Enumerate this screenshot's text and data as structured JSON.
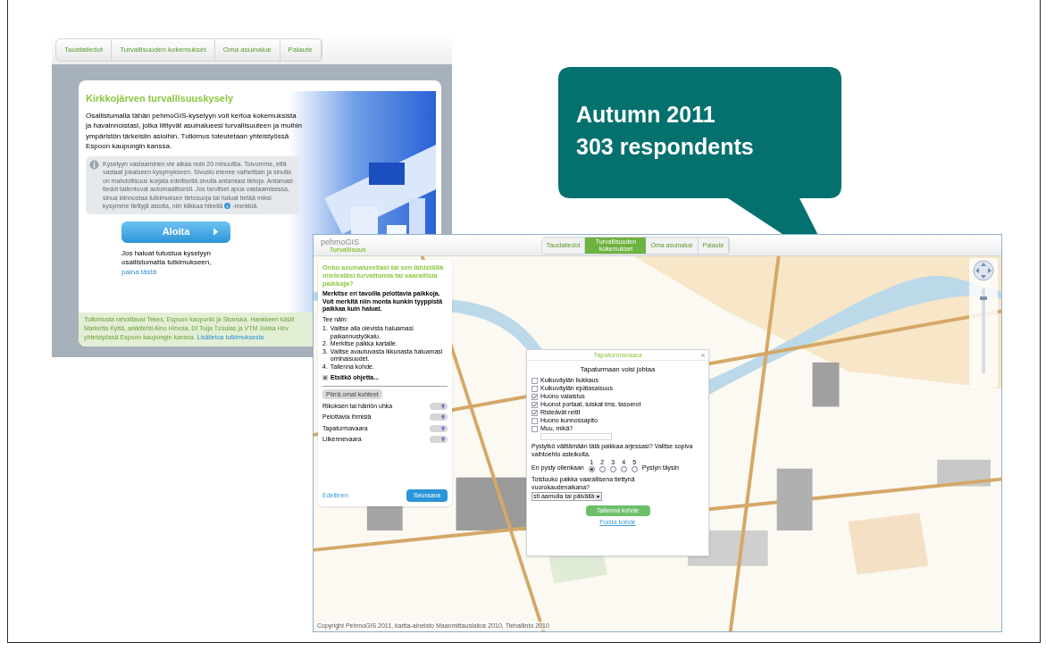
{
  "survey_intro": {
    "tabs": [
      {
        "label": "Taustatiedot",
        "selected": false
      },
      {
        "label": "Turvallisuuden kokemukset",
        "selected": false
      },
      {
        "label": "Oma asuinalue",
        "selected": false
      },
      {
        "label": "Palaute",
        "selected": false
      }
    ],
    "title": "Kirkkojärven turvallisuuskysely",
    "intro": "Osallistumalla tähän pehmoGIS-kyselyyn voit kertoa kokemuksista ja havainnoistasi, jotka liittyvät asuinalueesi turvallisuuteen ja muihin ympäristön tärkeisiin asioihin. Tutkimus toteutetaan yhteistyössä Espoon kaupungin kanssa.",
    "info_note": "Kyselyyn vastaaminen vie aikaa noin 20 minuuttia. Toivomme, että vastaat jokaiseen kysymykseen. Sivusto etenee vaiheittain ja sinulla on mahdollisuus korjata edellisellä sivulla antamiasi tietoja. Antamasi tiedot tallentuvat automaattisesti. Jos tarvitset apua vastaamisessa, sinua kiinnostaa tutkimuksen tietosuoja tai haluat tietää miksi ",
    "info_note_last": "kysymme tiettyjä asioita, niin klikkaa hiirellä",
    "info_note_end": "-merkkiä.",
    "start_button": "Aloita",
    "explore_text": "Jos haluat tutustua kyselyyn osallistumatta tutkimukseen,",
    "explore_link": "paina tästä",
    "footer_lines": [
      "Tutkimusta rahoittavat Tekes, Espoon kaupunki ja Skanska. Hankkeen käsill",
      "Marketta Kyttä, arkkitehti Aino Hirvola, DI Tuija Tzoulas ja VTM Jukka Hirv",
      "yhteistyössä Espoon kaupungin kanssa."
    ],
    "footer_link": "Lisätietoa tutkimuksesta",
    "footer_end": "."
  },
  "map_survey": {
    "logo": "pehmoGIS",
    "logo_subtitle": "Turvallisuus",
    "steps": [
      {
        "label": "Taustatiedot",
        "selected": false
      },
      {
        "label": "Turvallisuuden kokemukset",
        "selected": true
      },
      {
        "label": "Oma asuinalue",
        "selected": false
      },
      {
        "label": "Palaute",
        "selected": false
      }
    ],
    "side_panel": {
      "question": "Onko asuinalueellasi tai sen lähistöllä mielestäsi turvattomia tai vaarallisia paikkoja?",
      "description": "Merkitse eri tavoilla pelottavia paikkoja. Voit merkitä niin monta kunkin tyyppistä paikkaa kuin haluat.",
      "how_label": "Tee näin:",
      "instructions": [
        {
          "number": "1.",
          "text": "Valitse alla olevista haluamasi paikannustyökalu."
        },
        {
          "number": "2.",
          "text": "Merkitse paikka kartalle."
        },
        {
          "number": "3.",
          "text": "Valitse avautuvasta ikkunasta haluamasi ominaisuudet."
        },
        {
          "number": "4.",
          "text": "Tallenna kohde."
        }
      ],
      "help_toggle": "Etsitkö ohjetta...",
      "draw_button": "Piirrä omat kohteet",
      "categories": [
        "Rikoksen tai häiriön uhka",
        "Pelottavia ihmisiä",
        "Tapaturmavaara",
        "Liikennevaara"
      ],
      "back_link": "Edellinen",
      "next_button": "Seuraava"
    },
    "popup": {
      "title": "Tapaturmavaara",
      "heading": "Tapaturmaan voisi johtaa",
      "options": [
        {
          "label": "Kulkuväylän liukkaus",
          "checked": false
        },
        {
          "label": "Kulkuväylän epätasaisuus",
          "checked": false
        },
        {
          "label": "Huono valaistus",
          "checked": true
        },
        {
          "label": "Huonot portaat, luiskat tms. tasoerot",
          "checked": true
        },
        {
          "label": "Risteävät reitit",
          "checked": true
        },
        {
          "label": "Huono kunnossapito",
          "checked": false
        },
        {
          "label": "Muu, mikä?",
          "checked": false
        }
      ],
      "question_avoid": "Pystytkö välttämään tätä paikkaa arjessasi? Valitse sopiva vaihtoehto asteikolta.",
      "scale": [
        {
          "label": "1",
          "selected": true
        },
        {
          "label": "2",
          "selected": false
        },
        {
          "label": "3",
          "selected": false
        },
        {
          "label": "4",
          "selected": false
        },
        {
          "label": "5",
          "selected": false
        }
      ],
      "scale_min": "En pysty ollenkaan",
      "scale_max": "Pystyn täysin",
      "question_time": "Toistuuko paikka vaarallisena tiettynä vuorokaudenaikana?",
      "time_select": "sti aamulla tai päivällä",
      "save_button": "Tallenna kohde",
      "delete_link": "Poista kohde"
    },
    "zoom": {
      "level": 0.9
    },
    "copyright": "Copyright PehmoGIS 2011, kartta-aineisto Maanmittauslaitos 2010, Tiehallinto 2010"
  },
  "callout": {
    "lines": [
      "Autumn 2011",
      "303 respondents"
    ]
  }
}
